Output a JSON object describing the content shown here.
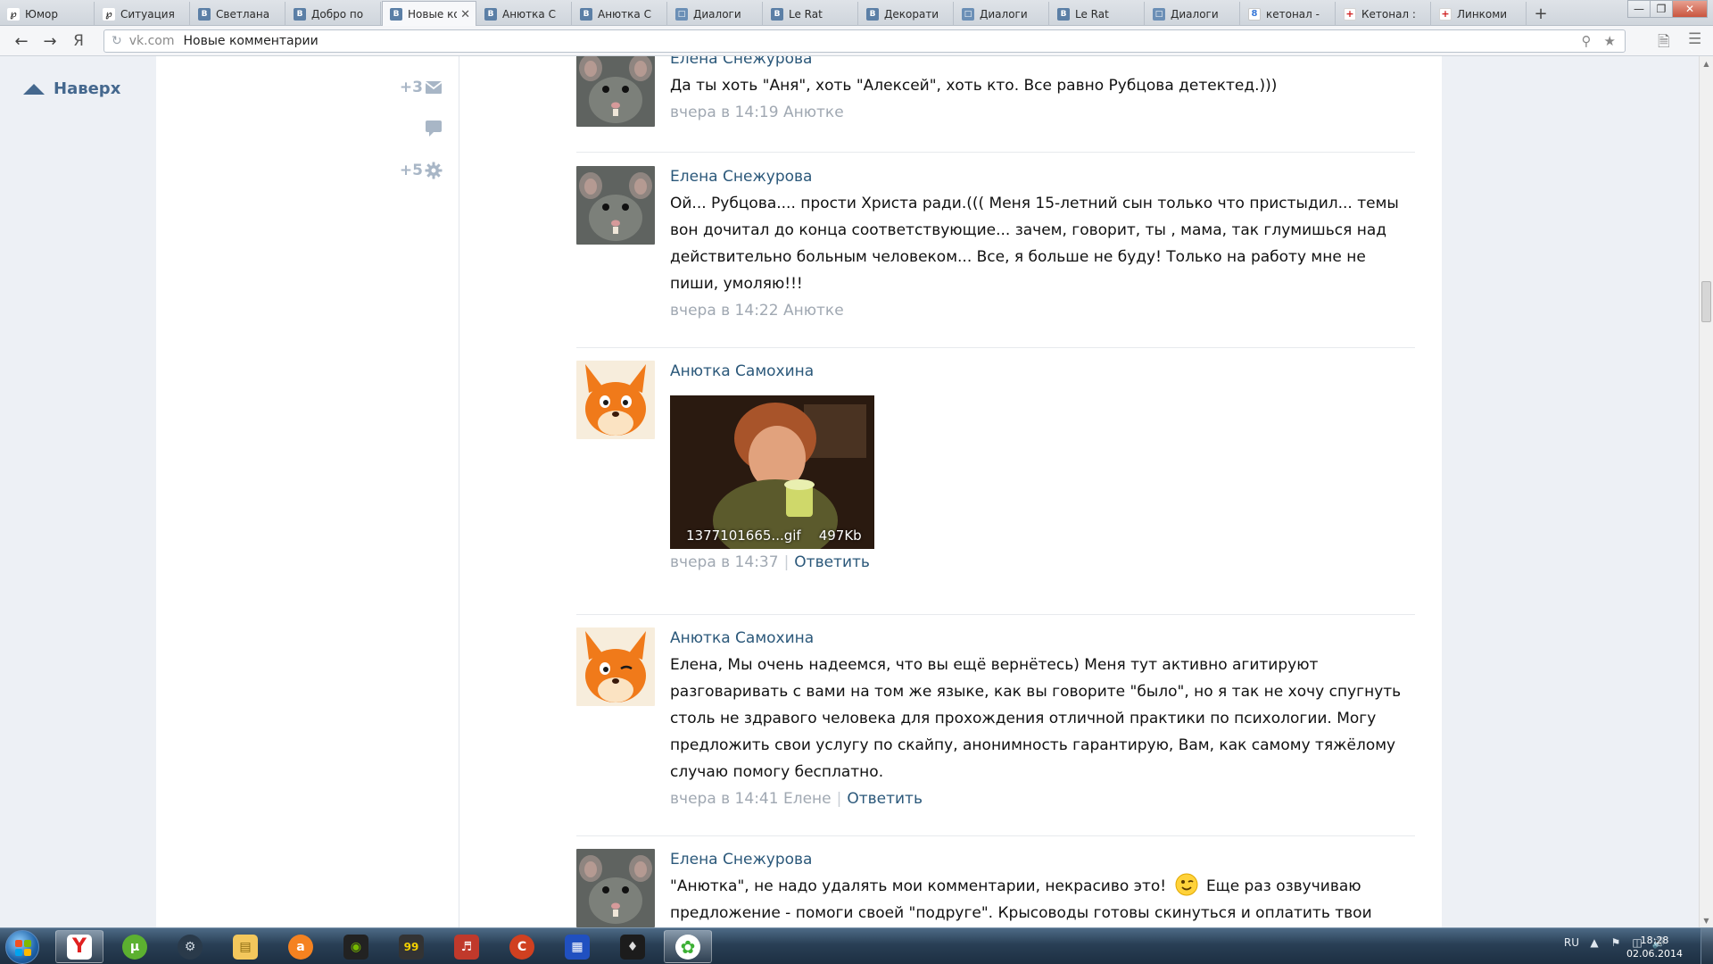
{
  "browser": {
    "tabs": [
      {
        "label": "Юмор",
        "icon": "rat-icon"
      },
      {
        "label": "Ситуация",
        "icon": "rat-icon"
      },
      {
        "label": "Светлана",
        "icon": "vk-icon"
      },
      {
        "label": "Добро по",
        "icon": "vk-icon"
      },
      {
        "label": "Новые ко",
        "icon": "vk-icon",
        "active": true
      },
      {
        "label": "Анютка С",
        "icon": "vk-icon"
      },
      {
        "label": "Анютка С",
        "icon": "vk-icon"
      },
      {
        "label": "Диалоги",
        "icon": "dialogs-icon"
      },
      {
        "label": "Le Rat",
        "icon": "vk-icon"
      },
      {
        "label": "Декорати",
        "icon": "vk-icon"
      },
      {
        "label": "Диалоги",
        "icon": "dialogs-icon"
      },
      {
        "label": "Le Rat",
        "icon": "vk-icon"
      },
      {
        "label": "Диалоги",
        "icon": "dialogs-icon"
      },
      {
        "label": "кетонал -",
        "icon": "google-icon"
      },
      {
        "label": "Кетонал :",
        "icon": "medical-icon"
      },
      {
        "label": "Линкоми",
        "icon": "medical-icon"
      }
    ],
    "new_tab": "+",
    "address": {
      "logo": "Я",
      "domain": "vk.com",
      "title": "Новые комментарии"
    }
  },
  "page": {
    "to_top": "Наверх",
    "side_counters": [
      {
        "value": "+3",
        "icon": "envelope-icon"
      },
      {
        "value": "",
        "icon": "speech-bubble-icon"
      },
      {
        "value": "+5",
        "icon": "gear-icon"
      }
    ],
    "comments": [
      {
        "author": "Елена Снежурова",
        "avatar": "rat-avatar",
        "text": "Да ты хоть \"Аня\", хоть \"Алексей\", хоть кто. Все равно Рубцова детектед.)))",
        "time": "вчера в 14:19",
        "reply_to": "Анютке"
      },
      {
        "author": "Елена Снежурова",
        "avatar": "rat-avatar",
        "text": "Ой... Рубцова.... прости Христа ради.((( Меня 15-летний сын только что пристыдил... темы вон дочитал до конца соответствующие... зачем, говорит, ты , мама, так глумишься над действительно больным человеком... Все, я больше не буду! Только на работу мне не пиши, умоляю!!!",
        "time": "вчера в 14:22",
        "reply_to": "Анютке"
      },
      {
        "author": "Анютка Самохина",
        "avatar": "fox-avatar",
        "attachment": {
          "filename": "1377101665...gif",
          "size": "497Kb"
        },
        "time": "вчера в 14:37",
        "reply_label": "Ответить"
      },
      {
        "author": "Анютка Самохина",
        "avatar": "fox-avatar",
        "text": "Елена, Мы очень надеемся, что вы ещё вернётесь) Меня тут активно агитируют разговаривать с вами на том же языке, как вы говорите \"было\", но я так не хочу спугнуть столь не здравого человека для прохождения отличной практики по психологии. Могу предложить свои услугу по скайпу, анонимность гарантирую, Вам, как самому тяжёлому случаю помогу бесплатно.",
        "time": "вчера в 14:41",
        "reply_to": "Елене",
        "reply_label": "Ответить"
      },
      {
        "author": "Елена Снежурова",
        "avatar": "rat-avatar",
        "text": "\"Анютка\", не надо удалять мои комментарии, некрасиво это!",
        "text_cont": "Еще раз озвучиваю предложение - помоги своей \"подруге\". Крысоводы готовы скинуться и оплатить твои"
      }
    ]
  },
  "taskbar": {
    "apps": [
      "start-button",
      "yandex-browser-icon",
      "utorrent-icon",
      "steam-icon",
      "explorer-folder-icon",
      "avast-icon",
      "nvidia-icon",
      "99-app-icon",
      "speaker-app-icon",
      "ccleaner-icon",
      "paint-grid-icon",
      "skyrim-icon",
      "icq-icon"
    ],
    "lang": "RU",
    "time": "18:28",
    "date": "02.06.2014"
  }
}
